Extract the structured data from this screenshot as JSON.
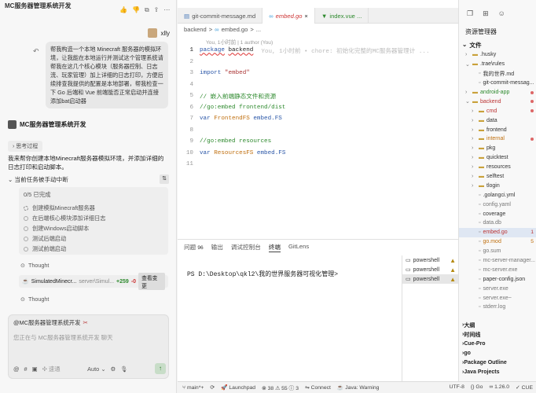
{
  "chat": {
    "title": "MC服务器管理系统开发",
    "user_name": "xlly",
    "user_message": "帮我构造一个本地 Minecraft 服务器的模拟环境，让我能在本地运行并测试这个管理系统请帮我在这几个核心模块（服务器控制、日志流、玩家管理）加上详细的日志打印，方便后续排查我提供的配置是本地部署，帮我检查一下 Go 后端和 Vue 前端能否正常启动并连接添加bat启动器",
    "agent_name": "MC服务器管理系统开发",
    "thinking_label": "思考过程",
    "agent_text": "我来帮你创建本地Minecraft服务器模拟环境，并添加详细的日志打印和启动脚本。",
    "task_header": "当前任务被手动中断",
    "task_count": "0/5 已完成",
    "tasks": [
      "创建模拟Minecraft服务器",
      "在后端核心模块添加详细日志",
      "创建Windows启动脚本",
      "测试后端启动",
      "测试前端启动"
    ],
    "thought_label": "Thought",
    "file_card": {
      "name": "SimulatedMinecr...",
      "path": "server\\Simul...",
      "added": "+259",
      "removed": "-0",
      "review_label": "查看变更"
    },
    "input": {
      "context": "@MC服务器管理系统开发",
      "placeholder": "您正在与 MC服务器管理系统开发 聊天",
      "mode": "速通",
      "model": "Auto"
    }
  },
  "editor": {
    "tabs": [
      {
        "label": "git-commit-message.md",
        "style": "normal"
      },
      {
        "label": "embed.go",
        "style": "red"
      },
      {
        "label": "index.vue ...",
        "style": "green"
      }
    ],
    "breadcrumb": [
      "backend",
      ">",
      "embed.go",
      ">",
      "..."
    ],
    "blame": "You, 1小时前 | 1 author (You)",
    "ghost_blame": "You, 1小时前 • chore: 初始化完整的MC服务器管理计 ...",
    "lines": [
      {
        "n": "1",
        "text": "package backend"
      },
      {
        "n": "2",
        "text": ""
      },
      {
        "n": "3",
        "text": "import \"embed\""
      },
      {
        "n": "4",
        "text": ""
      },
      {
        "n": "5",
        "text": "// 嵌入前端静态文件和资源"
      },
      {
        "n": "6",
        "text": "//go:embed frontend/dist"
      },
      {
        "n": "7",
        "text": "var FrontendFS embed.FS"
      },
      {
        "n": "8",
        "text": ""
      },
      {
        "n": "9",
        "text": "//go:embed resources"
      },
      {
        "n": "10",
        "text": "var ResourcesFS embed.FS"
      },
      {
        "n": "11",
        "text": ""
      }
    ]
  },
  "panel": {
    "tabs": [
      "问题",
      "输出",
      "调试控制台",
      "终端",
      "GitLens"
    ],
    "problems_count": "96",
    "terminal_prompt": "PS D:\\Desktop\\qkl2\\我的世界服务器可视化管理>",
    "terminals": [
      "powershell",
      "powershell",
      "powershell"
    ]
  },
  "explorer": {
    "title": "资源管理器",
    "section": "文件",
    "nodes": [
      {
        "label": ".husky",
        "indent": 1,
        "arrow": ">",
        "style": "normal"
      },
      {
        "label": ".trae\\rules",
        "indent": 1,
        "arrow": "v",
        "style": "normal"
      },
      {
        "label": "我的世界.md",
        "indent": 2,
        "arrow": "",
        "style": "normal"
      },
      {
        "label": "git-commit-messag...",
        "indent": 2,
        "arrow": "",
        "style": "normal"
      },
      {
        "label": "android-app",
        "indent": 1,
        "arrow": ">",
        "style": "green",
        "dot": true
      },
      {
        "label": "backend",
        "indent": 1,
        "arrow": "v",
        "style": "red",
        "dot": true
      },
      {
        "label": "cmd",
        "indent": 2,
        "arrow": ">",
        "style": "red",
        "dot": true
      },
      {
        "label": "data",
        "indent": 2,
        "arrow": ">",
        "style": "normal"
      },
      {
        "label": "frontend",
        "indent": 2,
        "arrow": ">",
        "style": "normal"
      },
      {
        "label": "internal",
        "indent": 2,
        "arrow": ">",
        "style": "orange",
        "dot": true
      },
      {
        "label": "pkg",
        "indent": 2,
        "arrow": ">",
        "style": "normal"
      },
      {
        "label": "quicktest",
        "indent": 2,
        "arrow": ">",
        "style": "normal"
      },
      {
        "label": "resources",
        "indent": 2,
        "arrow": ">",
        "style": "normal"
      },
      {
        "label": "selftest",
        "indent": 2,
        "arrow": ">",
        "style": "normal"
      },
      {
        "label": "tlogin",
        "indent": 2,
        "arrow": ">",
        "style": "normal"
      },
      {
        "label": ".golangci.yml",
        "indent": 2,
        "arrow": "",
        "style": "normal"
      },
      {
        "label": "config.yaml",
        "indent": 2,
        "arrow": "",
        "style": "grey"
      },
      {
        "label": "coverage",
        "indent": 2,
        "arrow": "",
        "style": "normal"
      },
      {
        "label": "data.db",
        "indent": 2,
        "arrow": "",
        "style": "grey"
      },
      {
        "label": "embed.go",
        "indent": 2,
        "arrow": "",
        "style": "red",
        "sel": true,
        "count": "1"
      },
      {
        "label": "go.mod",
        "indent": 2,
        "arrow": "",
        "style": "orange",
        "count": "5"
      },
      {
        "label": "go.sum",
        "indent": 2,
        "arrow": "",
        "style": "grey"
      },
      {
        "label": "mc-server-manager...",
        "indent": 2,
        "arrow": "",
        "style": "grey"
      },
      {
        "label": "mc-server.exe",
        "indent": 2,
        "arrow": "",
        "style": "grey"
      },
      {
        "label": "paper-config.json",
        "indent": 2,
        "arrow": "",
        "style": "normal"
      },
      {
        "label": "server.exe",
        "indent": 2,
        "arrow": "",
        "style": "grey"
      },
      {
        "label": "server.exe~",
        "indent": 2,
        "arrow": "",
        "style": "grey"
      },
      {
        "label": "stderr.log",
        "indent": 2,
        "arrow": "",
        "style": "grey"
      }
    ],
    "outline": [
      "大纲",
      "时间线",
      "Cue-Pro",
      "go",
      "Package Outline",
      "Java Projects"
    ]
  },
  "status": {
    "branch": "main*+",
    "launchpad": "Launchpad",
    "errors": "38",
    "warnings": "55",
    "info": "3",
    "connect": "Connect",
    "java": "Java: Warning",
    "encoding": "UTF-8",
    "go_label": "Go",
    "go_version": "1.26.0",
    "cue": "CUE"
  }
}
